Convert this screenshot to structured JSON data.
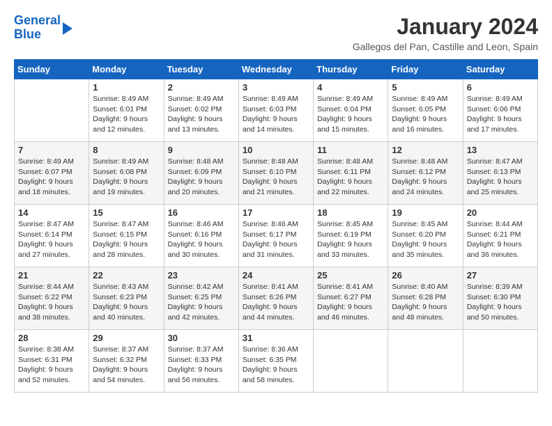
{
  "header": {
    "logo_line1": "General",
    "logo_line2": "Blue",
    "month": "January 2024",
    "location": "Gallegos del Pan, Castille and Leon, Spain"
  },
  "weekdays": [
    "Sunday",
    "Monday",
    "Tuesday",
    "Wednesday",
    "Thursday",
    "Friday",
    "Saturday"
  ],
  "weeks": [
    [
      {
        "day": "",
        "sunrise": "",
        "sunset": "",
        "daylight": ""
      },
      {
        "day": "1",
        "sunrise": "Sunrise: 8:49 AM",
        "sunset": "Sunset: 6:01 PM",
        "daylight": "Daylight: 9 hours and 12 minutes."
      },
      {
        "day": "2",
        "sunrise": "Sunrise: 8:49 AM",
        "sunset": "Sunset: 6:02 PM",
        "daylight": "Daylight: 9 hours and 13 minutes."
      },
      {
        "day": "3",
        "sunrise": "Sunrise: 8:49 AM",
        "sunset": "Sunset: 6:03 PM",
        "daylight": "Daylight: 9 hours and 14 minutes."
      },
      {
        "day": "4",
        "sunrise": "Sunrise: 8:49 AM",
        "sunset": "Sunset: 6:04 PM",
        "daylight": "Daylight: 9 hours and 15 minutes."
      },
      {
        "day": "5",
        "sunrise": "Sunrise: 8:49 AM",
        "sunset": "Sunset: 6:05 PM",
        "daylight": "Daylight: 9 hours and 16 minutes."
      },
      {
        "day": "6",
        "sunrise": "Sunrise: 8:49 AM",
        "sunset": "Sunset: 6:06 PM",
        "daylight": "Daylight: 9 hours and 17 minutes."
      }
    ],
    [
      {
        "day": "7",
        "sunrise": "Sunrise: 8:49 AM",
        "sunset": "Sunset: 6:07 PM",
        "daylight": "Daylight: 9 hours and 18 minutes."
      },
      {
        "day": "8",
        "sunrise": "Sunrise: 8:49 AM",
        "sunset": "Sunset: 6:08 PM",
        "daylight": "Daylight: 9 hours and 19 minutes."
      },
      {
        "day": "9",
        "sunrise": "Sunrise: 8:48 AM",
        "sunset": "Sunset: 6:09 PM",
        "daylight": "Daylight: 9 hours and 20 minutes."
      },
      {
        "day": "10",
        "sunrise": "Sunrise: 8:48 AM",
        "sunset": "Sunset: 6:10 PM",
        "daylight": "Daylight: 9 hours and 21 minutes."
      },
      {
        "day": "11",
        "sunrise": "Sunrise: 8:48 AM",
        "sunset": "Sunset: 6:11 PM",
        "daylight": "Daylight: 9 hours and 22 minutes."
      },
      {
        "day": "12",
        "sunrise": "Sunrise: 8:48 AM",
        "sunset": "Sunset: 6:12 PM",
        "daylight": "Daylight: 9 hours and 24 minutes."
      },
      {
        "day": "13",
        "sunrise": "Sunrise: 8:47 AM",
        "sunset": "Sunset: 6:13 PM",
        "daylight": "Daylight: 9 hours and 25 minutes."
      }
    ],
    [
      {
        "day": "14",
        "sunrise": "Sunrise: 8:47 AM",
        "sunset": "Sunset: 6:14 PM",
        "daylight": "Daylight: 9 hours and 27 minutes."
      },
      {
        "day": "15",
        "sunrise": "Sunrise: 8:47 AM",
        "sunset": "Sunset: 6:15 PM",
        "daylight": "Daylight: 9 hours and 28 minutes."
      },
      {
        "day": "16",
        "sunrise": "Sunrise: 8:46 AM",
        "sunset": "Sunset: 6:16 PM",
        "daylight": "Daylight: 9 hours and 30 minutes."
      },
      {
        "day": "17",
        "sunrise": "Sunrise: 8:46 AM",
        "sunset": "Sunset: 6:17 PM",
        "daylight": "Daylight: 9 hours and 31 minutes."
      },
      {
        "day": "18",
        "sunrise": "Sunrise: 8:45 AM",
        "sunset": "Sunset: 6:19 PM",
        "daylight": "Daylight: 9 hours and 33 minutes."
      },
      {
        "day": "19",
        "sunrise": "Sunrise: 8:45 AM",
        "sunset": "Sunset: 6:20 PM",
        "daylight": "Daylight: 9 hours and 35 minutes."
      },
      {
        "day": "20",
        "sunrise": "Sunrise: 8:44 AM",
        "sunset": "Sunset: 6:21 PM",
        "daylight": "Daylight: 9 hours and 36 minutes."
      }
    ],
    [
      {
        "day": "21",
        "sunrise": "Sunrise: 8:44 AM",
        "sunset": "Sunset: 6:22 PM",
        "daylight": "Daylight: 9 hours and 38 minutes."
      },
      {
        "day": "22",
        "sunrise": "Sunrise: 8:43 AM",
        "sunset": "Sunset: 6:23 PM",
        "daylight": "Daylight: 9 hours and 40 minutes."
      },
      {
        "day": "23",
        "sunrise": "Sunrise: 8:42 AM",
        "sunset": "Sunset: 6:25 PM",
        "daylight": "Daylight: 9 hours and 42 minutes."
      },
      {
        "day": "24",
        "sunrise": "Sunrise: 8:41 AM",
        "sunset": "Sunset: 6:26 PM",
        "daylight": "Daylight: 9 hours and 44 minutes."
      },
      {
        "day": "25",
        "sunrise": "Sunrise: 8:41 AM",
        "sunset": "Sunset: 6:27 PM",
        "daylight": "Daylight: 9 hours and 46 minutes."
      },
      {
        "day": "26",
        "sunrise": "Sunrise: 8:40 AM",
        "sunset": "Sunset: 6:28 PM",
        "daylight": "Daylight: 9 hours and 48 minutes."
      },
      {
        "day": "27",
        "sunrise": "Sunrise: 8:39 AM",
        "sunset": "Sunset: 6:30 PM",
        "daylight": "Daylight: 9 hours and 50 minutes."
      }
    ],
    [
      {
        "day": "28",
        "sunrise": "Sunrise: 8:38 AM",
        "sunset": "Sunset: 6:31 PM",
        "daylight": "Daylight: 9 hours and 52 minutes."
      },
      {
        "day": "29",
        "sunrise": "Sunrise: 8:37 AM",
        "sunset": "Sunset: 6:32 PM",
        "daylight": "Daylight: 9 hours and 54 minutes."
      },
      {
        "day": "30",
        "sunrise": "Sunrise: 8:37 AM",
        "sunset": "Sunset: 6:33 PM",
        "daylight": "Daylight: 9 hours and 56 minutes."
      },
      {
        "day": "31",
        "sunrise": "Sunrise: 8:36 AM",
        "sunset": "Sunset: 6:35 PM",
        "daylight": "Daylight: 9 hours and 58 minutes."
      },
      {
        "day": "",
        "sunrise": "",
        "sunset": "",
        "daylight": ""
      },
      {
        "day": "",
        "sunrise": "",
        "sunset": "",
        "daylight": ""
      },
      {
        "day": "",
        "sunrise": "",
        "sunset": "",
        "daylight": ""
      }
    ]
  ]
}
